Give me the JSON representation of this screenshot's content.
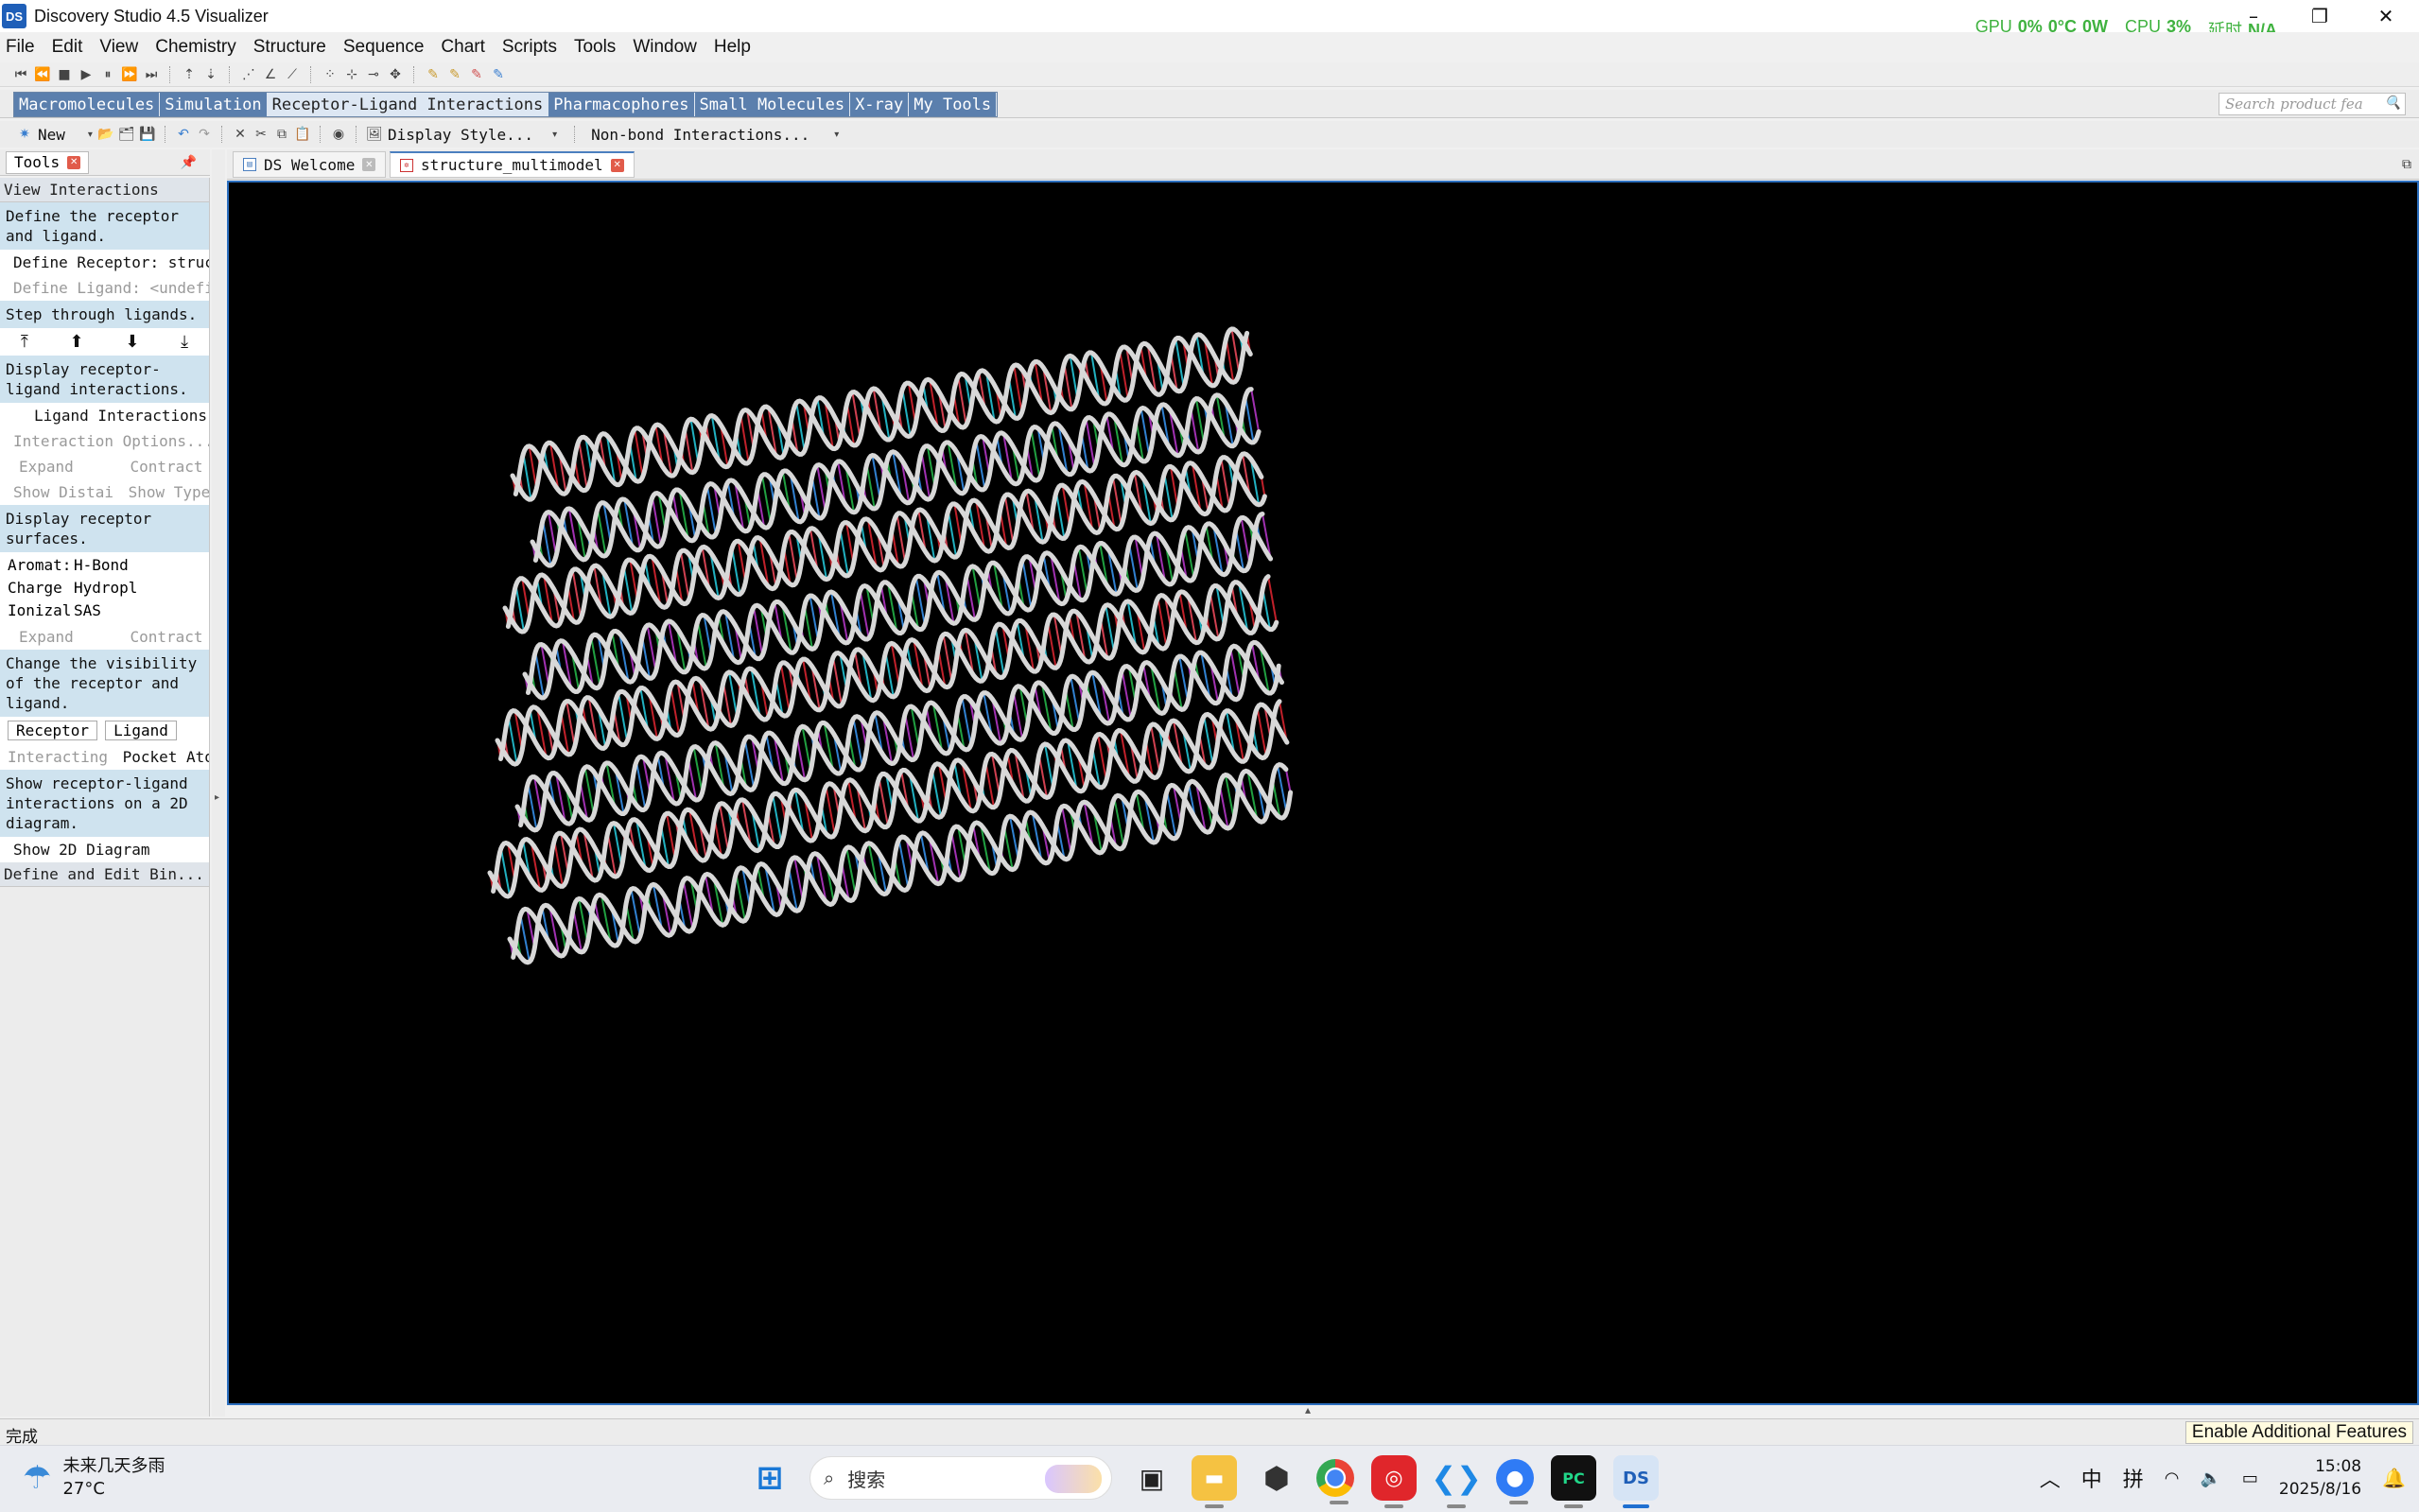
{
  "title": "Discovery Studio 4.5 Visualizer",
  "overlay": {
    "gpu_label": "GPU",
    "gpu_load": "0%",
    "gpu_temp": "0°C",
    "gpu_power": "0W",
    "cpu_label": "CPU",
    "cpu_load": "3%",
    "latency_label": "延时",
    "latency_value": "N/A"
  },
  "menu": [
    "File",
    "Edit",
    "View",
    "Chemistry",
    "Structure",
    "Sequence",
    "Chart",
    "Scripts",
    "Tools",
    "Window",
    "Help"
  ],
  "protocol_tabs": [
    "Macromolecules",
    "Simulation",
    "Receptor-Ligand Interactions",
    "Pharmacophores",
    "Small Molecules",
    "X-ray",
    "My Tools"
  ],
  "search_placeholder": "Search product fea",
  "toolbar2": {
    "new_label": "New",
    "display_style": "Display Style...",
    "nonbond": "Non-bond Interactions..."
  },
  "tools": {
    "tab_label": "Tools",
    "section_title": "View Interactions",
    "desc_define": "Define the receptor and ligand.",
    "define_receptor": "Define Receptor: struct",
    "define_ligand": "Define Ligand: <undefir",
    "desc_step": "Step through ligands.",
    "desc_display": "Display receptor-ligand interactions.",
    "ligand_interactions": "Ligand Interactions",
    "interaction_options": "Interaction Options...",
    "expand": "Expand",
    "contract": "Contract",
    "show_distance": "Show Distai",
    "show_types": "Show Types",
    "desc_surfaces": "Display receptor surfaces.",
    "surf_aromatic": "Aromat:",
    "surf_hbond": "H-Bond",
    "surf_charge": "Charge",
    "surf_hydro": "Hydropl",
    "surf_ioniz": "Ionizal",
    "surf_sas": "SAS",
    "expand2": "Expand",
    "contract2": "Contract",
    "desc_visibility": "Change the visibility of the receptor and ligand.",
    "btn_receptor": "Receptor",
    "btn_ligand": "Ligand",
    "interacting": "Interacting",
    "pocket_atoms": "Pocket Ator",
    "desc_2d": "Show receptor-ligand interactions on a 2D diagram.",
    "show_2d": "Show 2D Diagram",
    "define_edit": "Define and Edit Bin..."
  },
  "doc_tabs": [
    "DS Welcome",
    "structure_multimodel"
  ],
  "status_text": "完成",
  "enable_features": "Enable Additional Features",
  "taskbar": {
    "weather_line1": "未来几天多雨",
    "weather_line2": "27°C",
    "search_text": "搜索",
    "tray_ime1": "中",
    "tray_ime2": "拼",
    "time": "15:08",
    "date": "2025/8/16"
  },
  "colors": {
    "accent_blue": "#2c6fbf",
    "protocol_tab": "#5b7fad",
    "viewer_bg": "#000000",
    "overlay_green": "#3fb23f"
  }
}
